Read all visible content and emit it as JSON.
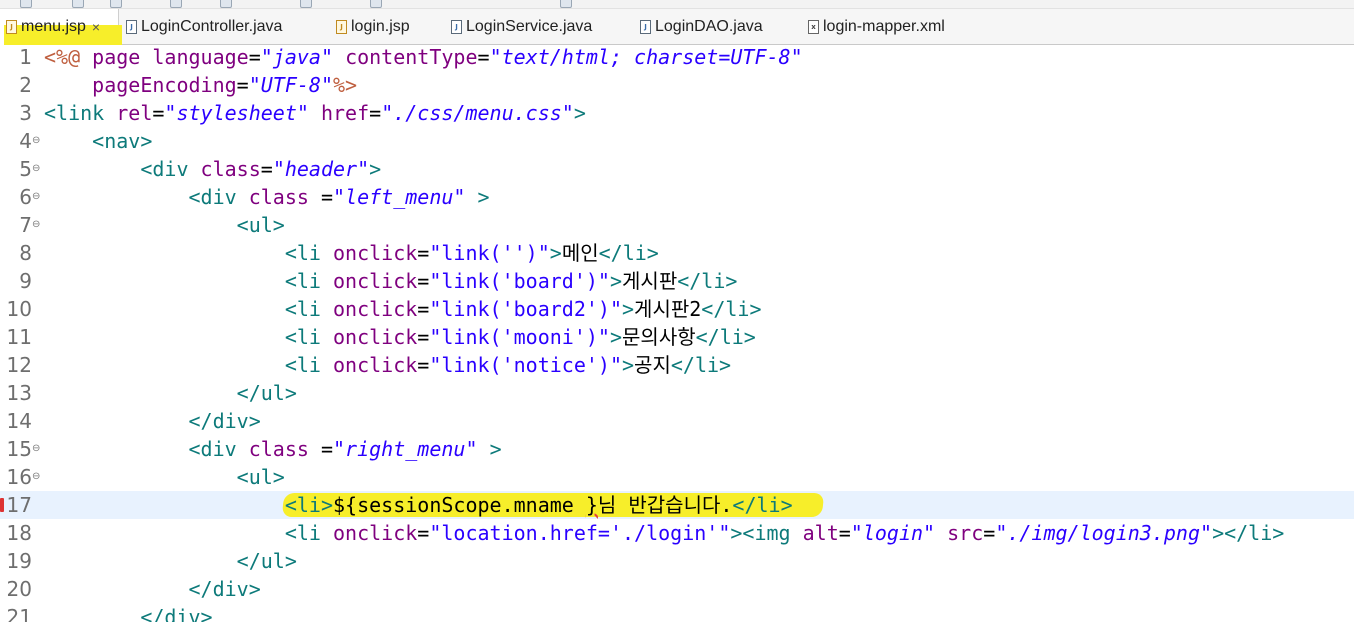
{
  "tabs": [
    {
      "label": "menu.jsp",
      "type": "jsp",
      "active": true,
      "close": "×"
    },
    {
      "label": "LoginController.java",
      "type": "java",
      "active": false
    },
    {
      "label": "login.jsp",
      "type": "jsp",
      "active": false
    },
    {
      "label": "LoginService.java",
      "type": "java",
      "active": false
    },
    {
      "label": "LoginDAO.java",
      "type": "java",
      "active": false
    },
    {
      "label": "login-mapper.xml",
      "type": "xml",
      "active": false
    }
  ],
  "icons": {
    "java": "J",
    "jsp": "J",
    "xml": "x"
  },
  "colors": {
    "highlight": "#f7ee2a",
    "tag": "#0d7a7a",
    "attr": "#7f007f",
    "string": "#2a00ff",
    "directive": "#bf5f3f",
    "current_line": "#e8f2fe"
  },
  "lines": [
    {
      "n": "1",
      "fold": "",
      "tokens": [
        [
          "dir",
          "<%@ "
        ],
        [
          "attr",
          "page "
        ],
        [
          "attr",
          "language"
        ],
        [
          "txt",
          "="
        ],
        [
          "str",
          "\"java\""
        ],
        [
          "txt",
          " "
        ],
        [
          "attr",
          "contentType"
        ],
        [
          "txt",
          "="
        ],
        [
          "str",
          "\"text/html; charset=UTF-8\""
        ]
      ]
    },
    {
      "n": "2",
      "fold": "",
      "tokens": [
        [
          "txt",
          "    "
        ],
        [
          "attr",
          "pageEncoding"
        ],
        [
          "txt",
          "="
        ],
        [
          "str",
          "\"UTF-8\""
        ],
        [
          "dir",
          "%>"
        ]
      ]
    },
    {
      "n": "3",
      "fold": "",
      "tokens": [
        [
          "tag",
          "<link "
        ],
        [
          "attr",
          "rel"
        ],
        [
          "txt",
          "="
        ],
        [
          "str",
          "\"stylesheet\""
        ],
        [
          "txt",
          " "
        ],
        [
          "attr",
          "href"
        ],
        [
          "txt",
          "="
        ],
        [
          "str",
          "\"./css/menu.css\""
        ],
        [
          "tag",
          ">"
        ]
      ]
    },
    {
      "n": "4",
      "fold": "⊖",
      "tokens": [
        [
          "txt",
          "    "
        ],
        [
          "tag",
          "<nav>"
        ]
      ]
    },
    {
      "n": "5",
      "fold": "⊖",
      "tokens": [
        [
          "txt",
          "        "
        ],
        [
          "tag",
          "<div "
        ],
        [
          "attr",
          "class"
        ],
        [
          "txt",
          "="
        ],
        [
          "str",
          "\"header\""
        ],
        [
          "tag",
          ">"
        ]
      ]
    },
    {
      "n": "6",
      "fold": "⊖",
      "tokens": [
        [
          "txt",
          "            "
        ],
        [
          "tag",
          "<div "
        ],
        [
          "attr",
          "class "
        ],
        [
          "txt",
          "="
        ],
        [
          "str",
          "\"left_menu\""
        ],
        [
          "txt",
          " "
        ],
        [
          "tag",
          ">"
        ]
      ]
    },
    {
      "n": "7",
      "fold": "⊖",
      "tokens": [
        [
          "txt",
          "                "
        ],
        [
          "tag",
          "<ul>"
        ]
      ]
    },
    {
      "n": "8",
      "fold": "",
      "tokens": [
        [
          "txt",
          "                    "
        ],
        [
          "tag",
          "<li "
        ],
        [
          "attr",
          "onclick"
        ],
        [
          "txt",
          "="
        ],
        [
          "strn",
          "\"link('')\""
        ],
        [
          "tag",
          ">"
        ],
        [
          "txt",
          "메인"
        ],
        [
          "tag",
          "</li>"
        ]
      ]
    },
    {
      "n": "9",
      "fold": "",
      "tokens": [
        [
          "txt",
          "                    "
        ],
        [
          "tag",
          "<li "
        ],
        [
          "attr",
          "onclick"
        ],
        [
          "txt",
          "="
        ],
        [
          "strn",
          "\"link('board')\""
        ],
        [
          "tag",
          ">"
        ],
        [
          "txt",
          "게시판"
        ],
        [
          "tag",
          "</li>"
        ]
      ]
    },
    {
      "n": "10",
      "fold": "",
      "tokens": [
        [
          "txt",
          "                    "
        ],
        [
          "tag",
          "<li "
        ],
        [
          "attr",
          "onclick"
        ],
        [
          "txt",
          "="
        ],
        [
          "strn",
          "\"link('board2')\""
        ],
        [
          "tag",
          ">"
        ],
        [
          "txt",
          "게시판2"
        ],
        [
          "tag",
          "</li>"
        ]
      ]
    },
    {
      "n": "11",
      "fold": "",
      "tokens": [
        [
          "txt",
          "                    "
        ],
        [
          "tag",
          "<li "
        ],
        [
          "attr",
          "onclick"
        ],
        [
          "txt",
          "="
        ],
        [
          "strn",
          "\"link('mooni')\""
        ],
        [
          "tag",
          ">"
        ],
        [
          "txt",
          "문의사항"
        ],
        [
          "tag",
          "</li>"
        ]
      ]
    },
    {
      "n": "12",
      "fold": "",
      "tokens": [
        [
          "txt",
          "                    "
        ],
        [
          "tag",
          "<li "
        ],
        [
          "attr",
          "onclick"
        ],
        [
          "txt",
          "="
        ],
        [
          "strn",
          "\"link('notice')\""
        ],
        [
          "tag",
          ">"
        ],
        [
          "txt",
          "공지"
        ],
        [
          "tag",
          "</li>"
        ]
      ]
    },
    {
      "n": "13",
      "fold": "",
      "tokens": [
        [
          "txt",
          "                "
        ],
        [
          "tag",
          "</ul>"
        ]
      ]
    },
    {
      "n": "14",
      "fold": "",
      "tokens": [
        [
          "txt",
          "            "
        ],
        [
          "tag",
          "</div>"
        ]
      ]
    },
    {
      "n": "15",
      "fold": "⊖",
      "tokens": [
        [
          "txt",
          "            "
        ],
        [
          "tag",
          "<div "
        ],
        [
          "attr",
          "class "
        ],
        [
          "txt",
          "="
        ],
        [
          "str",
          "\"right_menu\""
        ],
        [
          "txt",
          " "
        ],
        [
          "tag",
          ">"
        ]
      ]
    },
    {
      "n": "16",
      "fold": "⊖",
      "tokens": [
        [
          "txt",
          "                "
        ],
        [
          "tag",
          "<ul>"
        ]
      ]
    },
    {
      "n": "17",
      "fold": "",
      "current": true,
      "error": true,
      "highlight": true,
      "tokens": [
        [
          "txt",
          "                    "
        ],
        [
          "tag",
          "<li>"
        ],
        [
          "txt",
          "${sessionScope.mname "
        ],
        [
          "sq",
          "}"
        ],
        [
          "txt",
          "님 반갑습니다."
        ],
        [
          "tag",
          "</li>"
        ]
      ]
    },
    {
      "n": "18",
      "fold": "",
      "tokens": [
        [
          "txt",
          "                    "
        ],
        [
          "tag",
          "<li "
        ],
        [
          "attr",
          "onclick"
        ],
        [
          "txt",
          "="
        ],
        [
          "strn",
          "\"location.href='./login'\""
        ],
        [
          "tag",
          "><img "
        ],
        [
          "attr",
          "alt"
        ],
        [
          "txt",
          "="
        ],
        [
          "str",
          "\"login\""
        ],
        [
          "txt",
          " "
        ],
        [
          "attr",
          "src"
        ],
        [
          "txt",
          "="
        ],
        [
          "str",
          "\"./img/login3.png\""
        ],
        [
          "tag",
          "></li>"
        ]
      ]
    },
    {
      "n": "19",
      "fold": "",
      "tokens": [
        [
          "txt",
          "                "
        ],
        [
          "tag",
          "</ul>"
        ]
      ]
    },
    {
      "n": "20",
      "fold": "",
      "tokens": [
        [
          "txt",
          "            "
        ],
        [
          "tag",
          "</div>"
        ]
      ]
    },
    {
      "n": "21",
      "fold": "",
      "tokens": [
        [
          "txt",
          "        "
        ],
        [
          "tag",
          "</div>"
        ]
      ]
    }
  ]
}
